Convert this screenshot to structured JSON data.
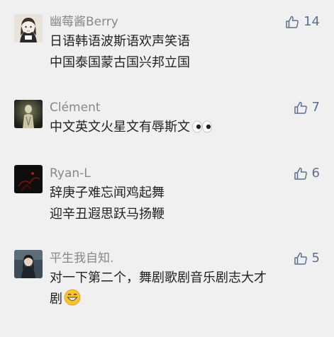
{
  "comments": [
    {
      "user": "幽莓酱Berry",
      "avatar_icon": "girl-avatar-icon",
      "likes": "14",
      "lines": [
        "日语韩语波斯语欢声笑语",
        "中国泰国蒙古国兴邦立国"
      ]
    },
    {
      "user": "Clément",
      "avatar_icon": "figure-avatar-icon",
      "likes": "7",
      "lines": [
        "中文英文火星文有辱斯文"
      ],
      "trailing_emoji": "eyes-emoji-icon"
    },
    {
      "user": "Ryan-L",
      "avatar_icon": "dark-avatar-icon",
      "likes": "6",
      "lines": [
        "辞庚子难忘闻鸡起舞",
        "迎辛丑遐思跃马扬鞭"
      ]
    },
    {
      "user": "平生我自知.",
      "avatar_icon": "woman-avatar-icon",
      "likes": "5",
      "lines": [
        "对一下第二个，舞剧歌剧音乐剧志大才",
        "剧"
      ],
      "trailing_emoji": "grinning-emoji-icon"
    }
  ],
  "colors": {
    "background": "#f0f0f0",
    "name": "#888888",
    "text": "#222222",
    "like": "#5d6f91"
  },
  "like_icon": "thumbs-up-icon"
}
